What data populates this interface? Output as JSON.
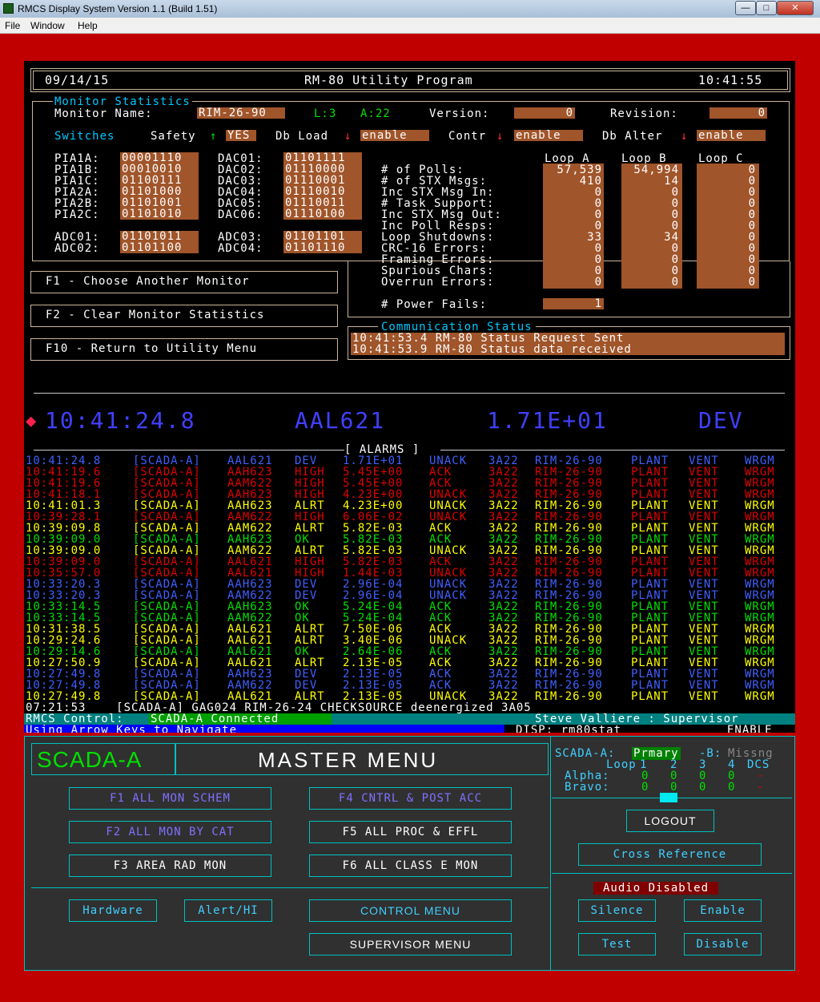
{
  "window": {
    "title": "RMCS Display System    Version 1.1    (Build 1.51)",
    "min": "—",
    "max": "□",
    "close": "✕"
  },
  "menubar": {
    "file": "File",
    "window": "Window",
    "help": "Help"
  },
  "header": {
    "date": "09/14/15",
    "title": "RM-80 Utility Program",
    "time": "10:41:55"
  },
  "monitor": {
    "section_title": "Monitor Statistics",
    "name_label": "Monitor Name:",
    "name_value": "RIM-26-90",
    "l_label": "L:3",
    "a_label": "A:22",
    "version_label": "Version:",
    "version_value": "0",
    "revision_label": "Revision:",
    "revision_value": "0",
    "switches_label": "Switches",
    "safety_label": "Safety",
    "safety_arrow": "↑",
    "safety_value": "YES",
    "dbload_label": "Db Load",
    "dbload_arrow": "↓",
    "dbload_value": "enable",
    "contr_label": "Contr",
    "contr_arrow": "↓",
    "contr_value": "enable",
    "dbalter_label": "Db Alter",
    "dbalter_arrow": "↓",
    "dbalter_value": "enable"
  },
  "pia": [
    {
      "label": "PIA1A:",
      "value": "00001110",
      "dlabel": "DAC01:",
      "dvalue": "01101111"
    },
    {
      "label": "PIA1B:",
      "value": "00010010",
      "dlabel": "DAC02:",
      "dvalue": "01110000"
    },
    {
      "label": "PIA1C:",
      "value": "01100111",
      "dlabel": "DAC03:",
      "dvalue": "01110001"
    },
    {
      "label": "PIA2A:",
      "value": "01101000",
      "dlabel": "DAC04:",
      "dvalue": "01110010"
    },
    {
      "label": "PIA2B:",
      "value": "01101001",
      "dlabel": "DAC05:",
      "dvalue": "01110011"
    },
    {
      "label": "PIA2C:",
      "value": "01101010",
      "dlabel": "DAC06:",
      "dvalue": "01110100"
    }
  ],
  "adc": [
    {
      "label": "ADC01:",
      "value": "01101011",
      "label2": "ADC03:",
      "value2": "01101101"
    },
    {
      "label": "ADC02:",
      "value": "01101100",
      "label2": "ADC04:",
      "value2": "01101110"
    }
  ],
  "loops": {
    "headers": [
      "Loop A",
      "Loop B",
      "Loop C"
    ],
    "rows": [
      {
        "label": "# of Polls:",
        "a": "57,539",
        "b": "54,994",
        "c": "0"
      },
      {
        "label": "# of STX Msgs:",
        "a": "410",
        "b": "14",
        "c": "0"
      },
      {
        "label": "Inc STX Msg In:",
        "a": "0",
        "b": "0",
        "c": "0"
      },
      {
        "label": "# Task Support:",
        "a": "0",
        "b": "0",
        "c": "0"
      },
      {
        "label": "Inc STX Msg Out:",
        "a": "0",
        "b": "0",
        "c": "0"
      },
      {
        "label": "Inc Poll Resps:",
        "a": "0",
        "b": "0",
        "c": "0"
      },
      {
        "label": "Loop Shutdowns:",
        "a": "33",
        "b": "34",
        "c": "0"
      },
      {
        "label": "CRC-16 Errors:",
        "a": "0",
        "b": "0",
        "c": "0"
      },
      {
        "label": "Framing Errors:",
        "a": "0",
        "b": "0",
        "c": "0"
      },
      {
        "label": "Spurious Chars:",
        "a": "0",
        "b": "0",
        "c": "0"
      },
      {
        "label": "Overrun Errors:",
        "a": "0",
        "b": "0",
        "c": "0"
      }
    ],
    "power_label": "# Power Fails:",
    "power_value": "1"
  },
  "fkeys": {
    "f1": "F1 - Choose Another Monitor",
    "f2": "F2 - Clear Monitor Statistics",
    "f10": "F10 - Return to Utility Menu"
  },
  "comm": {
    "title": "Communication Status",
    "lines": [
      "10:41:53.4 RM-80 Status Request Sent",
      "10:41:53.9 RM-80 Status data received"
    ]
  },
  "latest": {
    "diamond": "◆",
    "time": "10:41:24.8",
    "tag": "AAL621",
    "value": "1.71E+01",
    "status": "DEV"
  },
  "alarms_title": "[ ALARMS ]",
  "alarms": [
    {
      "t": "10:41:24.8",
      "src": "[SCADA-A]",
      "tag": "AAL621",
      "st": "DEV",
      "val": "1.71E+01",
      "ack": "UNACK",
      "loc": "3A22",
      "mon": "RIM-26-90",
      "p": "PLANT",
      "v": "VENT",
      "w": "WRGM",
      "color": "#4060ff"
    },
    {
      "t": "10:41:19.6",
      "src": "[SCADA-A]",
      "tag": "AAH623",
      "st": "HIGH",
      "val": "5.45E+00",
      "ack": "ACK",
      "loc": "3A22",
      "mon": "RIM-26-90",
      "p": "PLANT",
      "v": "VENT",
      "w": "WRGM",
      "color": "#e00000"
    },
    {
      "t": "10:41:19.6",
      "src": "[SCADA-A]",
      "tag": "AAM622",
      "st": "HIGH",
      "val": "5.45E+00",
      "ack": "ACK",
      "loc": "3A22",
      "mon": "RIM-26-90",
      "p": "PLANT",
      "v": "VENT",
      "w": "WRGM",
      "color": "#e00000"
    },
    {
      "t": "10:41:18.1",
      "src": "[SCADA-A]",
      "tag": "AAH623",
      "st": "HIGH",
      "val": "4.23E+00",
      "ack": "UNACK",
      "loc": "3A22",
      "mon": "RIM-26-90",
      "p": "PLANT",
      "v": "VENT",
      "w": "WRGM",
      "color": "#e00000"
    },
    {
      "t": "10:41:01.3",
      "src": "[SCADA-A]",
      "tag": "AAH623",
      "st": "ALRT",
      "val": "4.23E+00",
      "ack": "UNACK",
      "loc": "3A22",
      "mon": "RIM-26-90",
      "p": "PLANT",
      "v": "VENT",
      "w": "WRGM",
      "color": "#ffff00"
    },
    {
      "t": "10:39:28.1",
      "src": "[SCADA-A]",
      "tag": "AAM622",
      "st": "HIGH",
      "val": "6.06E-02",
      "ack": "UNACK",
      "loc": "3A22",
      "mon": "RIM-26-90",
      "p": "PLANT",
      "v": "VENT",
      "w": "WRGM",
      "color": "#e00000"
    },
    {
      "t": "10:39:09.8",
      "src": "[SCADA-A]",
      "tag": "AAM622",
      "st": "ALRT",
      "val": "5.82E-03",
      "ack": "ACK",
      "loc": "3A22",
      "mon": "RIM-26-90",
      "p": "PLANT",
      "v": "VENT",
      "w": "WRGM",
      "color": "#ffff00"
    },
    {
      "t": "10:39:09.0",
      "src": "[SCADA-A]",
      "tag": "AAH623",
      "st": "OK",
      "val": "5.82E-03",
      "ack": "ACK",
      "loc": "3A22",
      "mon": "RIM-26-90",
      "p": "PLANT",
      "v": "VENT",
      "w": "WRGM",
      "color": "#00e000"
    },
    {
      "t": "10:39:09.0",
      "src": "[SCADA-A]",
      "tag": "AAM622",
      "st": "ALRT",
      "val": "5.82E-03",
      "ack": "UNACK",
      "loc": "3A22",
      "mon": "RIM-26-90",
      "p": "PLANT",
      "v": "VENT",
      "w": "WRGM",
      "color": "#ffff00"
    },
    {
      "t": "10:39:09.0",
      "src": "[SCADA-A]",
      "tag": "AAL621",
      "st": "HIGH",
      "val": "5.82E-03",
      "ack": "ACK",
      "loc": "3A22",
      "mon": "RIM-26-90",
      "p": "PLANT",
      "v": "VENT",
      "w": "WRGM",
      "color": "#e00000"
    },
    {
      "t": "10:35:57.0",
      "src": "[SCADA-A]",
      "tag": "AAL621",
      "st": "HIGH",
      "val": "1.44E-03",
      "ack": "UNACK",
      "loc": "3A22",
      "mon": "RIM-26-90",
      "p": "PLANT",
      "v": "VENT",
      "w": "WRGM",
      "color": "#e00000"
    },
    {
      "t": "10:33:20.3",
      "src": "[SCADA-A]",
      "tag": "AAH623",
      "st": "DEV",
      "val": "2.96E-04",
      "ack": "UNACK",
      "loc": "3A22",
      "mon": "RIM-26-90",
      "p": "PLANT",
      "v": "VENT",
      "w": "WRGM",
      "color": "#4060ff"
    },
    {
      "t": "10:33:20.3",
      "src": "[SCADA-A]",
      "tag": "AAM622",
      "st": "DEV",
      "val": "2.96E-04",
      "ack": "UNACK",
      "loc": "3A22",
      "mon": "RIM-26-90",
      "p": "PLANT",
      "v": "VENT",
      "w": "WRGM",
      "color": "#4060ff"
    },
    {
      "t": "10:33:14.5",
      "src": "[SCADA-A]",
      "tag": "AAH623",
      "st": "OK",
      "val": "5.24E-04",
      "ack": "ACK",
      "loc": "3A22",
      "mon": "RIM-26-90",
      "p": "PLANT",
      "v": "VENT",
      "w": "WRGM",
      "color": "#00e000"
    },
    {
      "t": "10:33:14.5",
      "src": "[SCADA-A]",
      "tag": "AAM622",
      "st": "OK",
      "val": "5.24E-04",
      "ack": "ACK",
      "loc": "3A22",
      "mon": "RIM-26-90",
      "p": "PLANT",
      "v": "VENT",
      "w": "WRGM",
      "color": "#00e000"
    },
    {
      "t": "10:31:38.5",
      "src": "[SCADA-A]",
      "tag": "AAL621",
      "st": "ALRT",
      "val": "7.50E-06",
      "ack": "ACK",
      "loc": "3A22",
      "mon": "RIM-26-90",
      "p": "PLANT",
      "v": "VENT",
      "w": "WRGM",
      "color": "#ffff00"
    },
    {
      "t": "10:29:24.6",
      "src": "[SCADA-A]",
      "tag": "AAL621",
      "st": "ALRT",
      "val": "3.40E-06",
      "ack": "UNACK",
      "loc": "3A22",
      "mon": "RIM-26-90",
      "p": "PLANT",
      "v": "VENT",
      "w": "WRGM",
      "color": "#ffff00"
    },
    {
      "t": "10:29:14.6",
      "src": "[SCADA-A]",
      "tag": "AAL621",
      "st": "OK",
      "val": "2.64E-06",
      "ack": "ACK",
      "loc": "3A22",
      "mon": "RIM-26-90",
      "p": "PLANT",
      "v": "VENT",
      "w": "WRGM",
      "color": "#00e000"
    },
    {
      "t": "10:27:50.9",
      "src": "[SCADA-A]",
      "tag": "AAL621",
      "st": "ALRT",
      "val": "2.13E-05",
      "ack": "ACK",
      "loc": "3A22",
      "mon": "RIM-26-90",
      "p": "PLANT",
      "v": "VENT",
      "w": "WRGM",
      "color": "#ffff00"
    },
    {
      "t": "10:27:49.8",
      "src": "[SCADA-A]",
      "tag": "AAH623",
      "st": "DEV",
      "val": "2.13E-05",
      "ack": "ACK",
      "loc": "3A22",
      "mon": "RIM-26-90",
      "p": "PLANT",
      "v": "VENT",
      "w": "WRGM",
      "color": "#4060ff"
    },
    {
      "t": "10:27:49.8",
      "src": "[SCADA-A]",
      "tag": "AAM622",
      "st": "DEV",
      "val": "2.13E-05",
      "ack": "ACK",
      "loc": "3A22",
      "mon": "RIM-26-90",
      "p": "PLANT",
      "v": "VENT",
      "w": "WRGM",
      "color": "#4060ff"
    },
    {
      "t": "10:27:49.8",
      "src": "[SCADA-A]",
      "tag": "AAL621",
      "st": "ALRT",
      "val": "2.13E-05",
      "ack": "UNACK",
      "loc": "3A22",
      "mon": "RIM-26-90",
      "p": "PLANT",
      "v": "VENT",
      "w": "WRGM",
      "color": "#ffff00"
    }
  ],
  "last_alarm": "07:21:53    [SCADA-A] GAG024 RIM-26-24 CHECKSOURCE deenergized 3A05",
  "status": {
    "control_label": "RMCS Control:",
    "control_value": "SCADA-A Connected",
    "user": "Steve Valliere : Supervisor",
    "nav": "Using Arrow Keys to Navigate",
    "disp": "DISP: rm80stat",
    "enable": "ENABLE"
  },
  "menu": {
    "scada": "SCADA-A",
    "title": "MASTER MENU",
    "status_a": "SCADA-A:",
    "status_a_val": "Prmary",
    "status_b": "-B:",
    "status_b_val": "Missng",
    "loop_label": "Loop",
    "loop_cols": [
      "1",
      "2",
      "3",
      "4",
      "DCS"
    ],
    "alpha_label": "Alpha:",
    "alpha_vals": [
      "0",
      "0",
      "0",
      "0",
      "-"
    ],
    "bravo_label": "Bravo:",
    "bravo_vals": [
      "0",
      "0",
      "0",
      "0",
      "-"
    ],
    "f1": "F1  ALL MON SCHEM",
    "f2": "F2  ALL MON BY CAT",
    "f3": "F3  AREA RAD MON",
    "f4": "F4  CNTRL & POST ACC",
    "f5": "F5  ALL PROC & EFFL",
    "f6": "F6  ALL CLASS E MON",
    "logout": "LOGOUT",
    "cross": "Cross  Reference",
    "audio": "Audio Disabled",
    "hardware": "Hardware",
    "alert": "Alert/HI",
    "control": "CONTROL MENU",
    "supervisor": "SUPERVISOR  MENU",
    "silence": "Silence",
    "enable": "Enable",
    "test": "Test",
    "disable": "Disable"
  }
}
